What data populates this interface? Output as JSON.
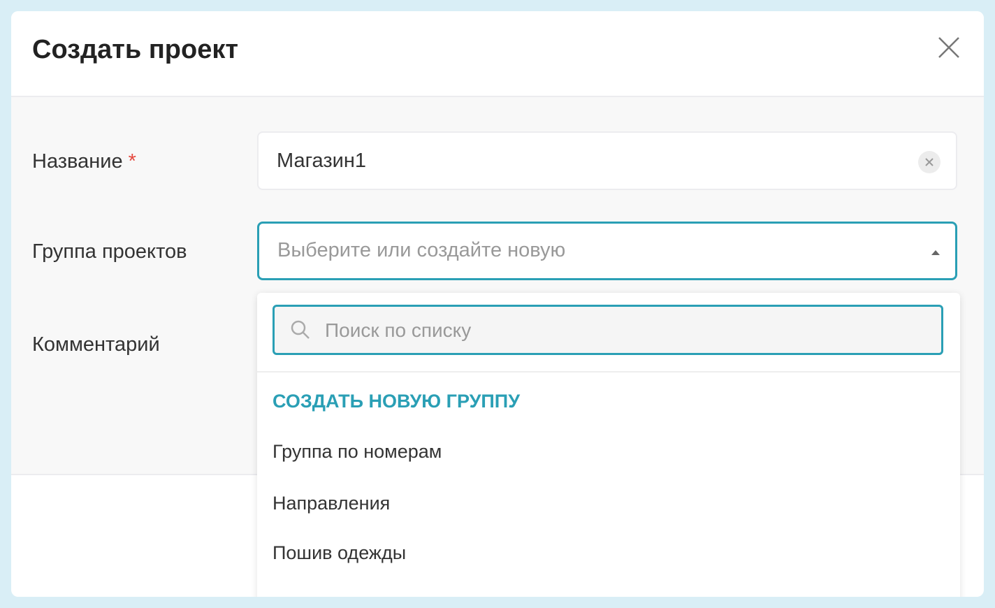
{
  "dialog": {
    "title": "Создать проект",
    "fields": {
      "name": {
        "label": "Название",
        "required_mark": "*",
        "value": "Магазин1"
      },
      "group": {
        "label": "Группа проектов",
        "placeholder": "Выберите или создайте новую"
      },
      "comment": {
        "label": "Комментарий"
      }
    },
    "dropdown": {
      "search_placeholder": "Поиск по списку",
      "create_label": "СОЗДАТЬ НОВУЮ ГРУППУ",
      "options": [
        "Группа по номерам",
        "Направления",
        "Пошив одежды"
      ]
    }
  },
  "colors": {
    "accent": "#2a9fb5",
    "required": "#e5483e",
    "frame": "#d9eef6"
  }
}
